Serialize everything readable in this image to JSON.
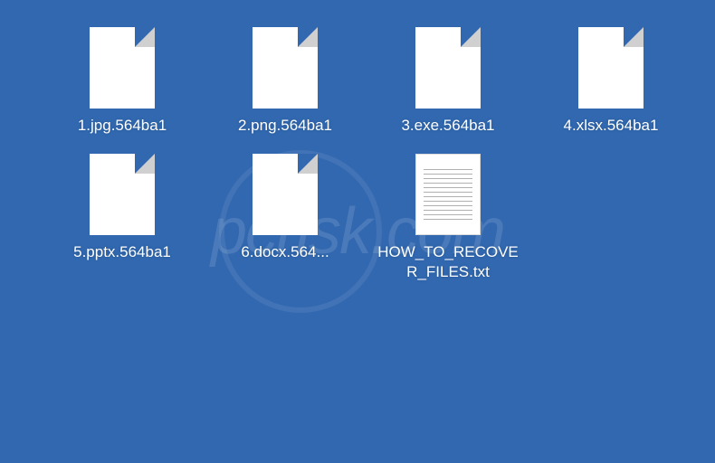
{
  "files": [
    {
      "name": "1.jpg.564ba1",
      "type": "blank"
    },
    {
      "name": "2.png.564ba1",
      "type": "blank"
    },
    {
      "name": "3.exe.564ba1",
      "type": "blank"
    },
    {
      "name": "4.xlsx.564ba1",
      "type": "blank"
    },
    {
      "name": "5.pptx.564ba1",
      "type": "blank"
    },
    {
      "name": "6.docx.564...",
      "type": "blank"
    },
    {
      "name": "HOW_TO_RECOVER_FILES.txt",
      "type": "text"
    }
  ],
  "watermark": "pcrisk.com"
}
